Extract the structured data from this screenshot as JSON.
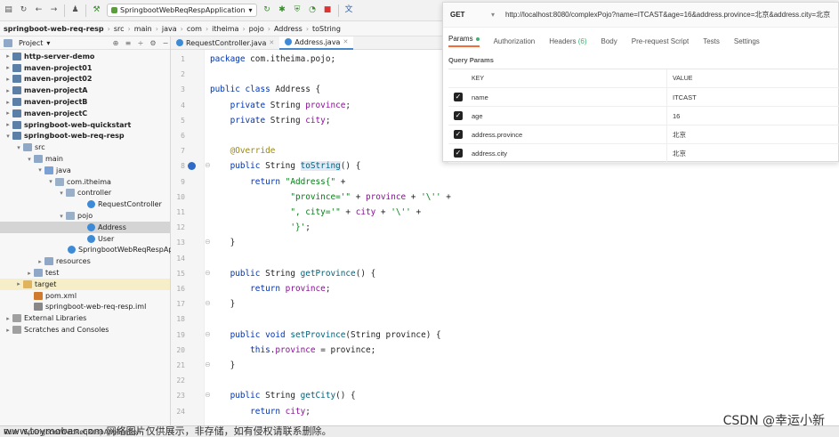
{
  "toolbar": {
    "run_config": "SpringbootWebReqRespApplication",
    "icons": [
      "save-icon",
      "sync-icon",
      "back-icon",
      "forward-icon",
      "vcs-icon",
      "build-icon",
      "run-icon",
      "debug-icon",
      "coverage-icon",
      "profile-icon",
      "stop-icon",
      "translate-icon"
    ]
  },
  "breadcrumb": [
    "springboot-web-req-resp",
    "src",
    "main",
    "java",
    "com",
    "itheima",
    "pojo",
    "Address",
    "toString"
  ],
  "project": {
    "header": "Project",
    "tree": [
      {
        "label": "http-server-demo",
        "bold": true,
        "icon": "module",
        "indent": 0,
        "arrow": "▸"
      },
      {
        "label": "maven-project01",
        "bold": true,
        "icon": "module",
        "indent": 0,
        "arrow": "▸"
      },
      {
        "label": "maven-project02",
        "bold": true,
        "icon": "module",
        "indent": 0,
        "arrow": "▸"
      },
      {
        "label": "maven-projectA",
        "bold": true,
        "icon": "module",
        "indent": 0,
        "arrow": "▸"
      },
      {
        "label": "maven-projectB",
        "bold": true,
        "icon": "module",
        "indent": 0,
        "arrow": "▸"
      },
      {
        "label": "maven-projectC",
        "bold": true,
        "icon": "module",
        "indent": 0,
        "arrow": "▸"
      },
      {
        "label": "springboot-web-quickstart",
        "bold": true,
        "icon": "module",
        "indent": 0,
        "arrow": "▸"
      },
      {
        "label": "springboot-web-req-resp",
        "bold": true,
        "icon": "module",
        "indent": 0,
        "arrow": "▾"
      },
      {
        "label": "src",
        "bold": false,
        "icon": "folder",
        "indent": 1,
        "arrow": "▾"
      },
      {
        "label": "main",
        "bold": false,
        "icon": "folder",
        "indent": 2,
        "arrow": "▾"
      },
      {
        "label": "java",
        "bold": false,
        "icon": "srcfolder",
        "indent": 3,
        "arrow": "▾"
      },
      {
        "label": "com.itheima",
        "bold": false,
        "icon": "pkg",
        "indent": 4,
        "arrow": "▾"
      },
      {
        "label": "controller",
        "bold": false,
        "icon": "pkg",
        "indent": 5,
        "arrow": "▾"
      },
      {
        "label": "RequestController",
        "bold": false,
        "icon": "cls",
        "indent": 7,
        "arrow": ""
      },
      {
        "label": "pojo",
        "bold": false,
        "icon": "pkg",
        "indent": 5,
        "arrow": "▾"
      },
      {
        "label": "Address",
        "bold": false,
        "icon": "cls",
        "indent": 7,
        "arrow": "",
        "selected": true
      },
      {
        "label": "User",
        "bold": false,
        "icon": "cls",
        "indent": 7,
        "arrow": ""
      },
      {
        "label": "SpringbootWebReqRespAp",
        "bold": false,
        "icon": "cls",
        "indent": 6,
        "arrow": ""
      },
      {
        "label": "resources",
        "bold": false,
        "icon": "folder",
        "indent": 3,
        "arrow": "▸"
      },
      {
        "label": "test",
        "bold": false,
        "icon": "folder",
        "indent": 2,
        "arrow": "▸"
      },
      {
        "label": "target",
        "bold": false,
        "icon": "excl",
        "indent": 1,
        "arrow": "▸",
        "target": true
      },
      {
        "label": "pom.xml",
        "bold": false,
        "icon": "xml",
        "indent": 2,
        "arrow": ""
      },
      {
        "label": "springboot-web-req-resp.iml",
        "bold": false,
        "icon": "iml",
        "indent": 2,
        "arrow": ""
      },
      {
        "label": "External Libraries",
        "bold": false,
        "icon": "lib",
        "indent": 0,
        "arrow": "▸"
      },
      {
        "label": "Scratches and Consoles",
        "bold": false,
        "icon": "lib",
        "indent": 0,
        "arrow": "▸"
      }
    ]
  },
  "editor": {
    "tabs": [
      {
        "label": "RequestController.java",
        "active": false
      },
      {
        "label": "Address.java",
        "active": true
      }
    ],
    "first_line": 1,
    "lines": [
      [
        [
          "kw",
          "package "
        ],
        [
          "plain",
          "com.itheima.pojo;"
        ]
      ],
      [],
      [
        [
          "kw",
          "public class "
        ],
        [
          "plain",
          "Address {"
        ]
      ],
      [
        [
          "plain",
          "    "
        ],
        [
          "kw",
          "private "
        ],
        [
          "plain",
          "String "
        ],
        [
          "fld",
          "province"
        ],
        [
          "plain",
          ";"
        ]
      ],
      [
        [
          "plain",
          "    "
        ],
        [
          "kw",
          "private "
        ],
        [
          "plain",
          "String "
        ],
        [
          "fld",
          "city"
        ],
        [
          "plain",
          ";"
        ]
      ],
      [],
      [
        [
          "plain",
          "    "
        ],
        [
          "ann",
          "@Override"
        ]
      ],
      [
        [
          "plain",
          "    "
        ],
        [
          "kw",
          "public "
        ],
        [
          "plain",
          "String "
        ],
        [
          "fn-hl",
          "toString"
        ],
        [
          "plain",
          "() {"
        ]
      ],
      [
        [
          "plain",
          "        "
        ],
        [
          "kw",
          "return "
        ],
        [
          "str",
          "\"Address{\""
        ],
        [
          "plain",
          " +"
        ]
      ],
      [
        [
          "plain",
          "                "
        ],
        [
          "str",
          "\"province='\""
        ],
        [
          "plain",
          " + "
        ],
        [
          "fld",
          "province"
        ],
        [
          "plain",
          " + "
        ],
        [
          "str",
          "'\\''"
        ],
        [
          "plain",
          " +"
        ]
      ],
      [
        [
          "plain",
          "                "
        ],
        [
          "str",
          "\", city='\""
        ],
        [
          "plain",
          " + "
        ],
        [
          "fld",
          "city"
        ],
        [
          "plain",
          " + "
        ],
        [
          "str",
          "'\\''"
        ],
        [
          "plain",
          " +"
        ]
      ],
      [
        [
          "plain",
          "                "
        ],
        [
          "str",
          "'}'"
        ],
        [
          "plain",
          ";"
        ]
      ],
      [
        [
          "plain",
          "    }"
        ]
      ],
      [],
      [
        [
          "plain",
          "    "
        ],
        [
          "kw",
          "public "
        ],
        [
          "plain",
          "String "
        ],
        [
          "fn",
          "getProvince"
        ],
        [
          "plain",
          "() {"
        ]
      ],
      [
        [
          "plain",
          "        "
        ],
        [
          "kw",
          "return "
        ],
        [
          "fld",
          "province"
        ],
        [
          "plain",
          ";"
        ]
      ],
      [
        [
          "plain",
          "    }"
        ]
      ],
      [],
      [
        [
          "plain",
          "    "
        ],
        [
          "kw",
          "public void "
        ],
        [
          "fn",
          "setProvince"
        ],
        [
          "plain",
          "(String province) {"
        ]
      ],
      [
        [
          "plain",
          "        "
        ],
        [
          "kw",
          "this"
        ],
        [
          "plain",
          "."
        ],
        [
          "fld",
          "province"
        ],
        [
          "plain",
          " = province;"
        ]
      ],
      [
        [
          "plain",
          "    }"
        ]
      ],
      [],
      [
        [
          "plain",
          "    "
        ],
        [
          "kw",
          "public "
        ],
        [
          "plain",
          "String "
        ],
        [
          "fn",
          "getCity"
        ],
        [
          "plain",
          "() {"
        ]
      ],
      [
        [
          "plain",
          "        "
        ],
        [
          "kw",
          "return "
        ],
        [
          "fld",
          "city"
        ],
        [
          "plain",
          ";"
        ]
      ]
    ]
  },
  "postman": {
    "method": "GET",
    "url": "http://localhost:8080/complexPojo?name=ITCAST&age=16&address.province=北京&address.city=北京",
    "tabs": [
      {
        "label": "Params",
        "active": true,
        "dot": true
      },
      {
        "label": "Authorization"
      },
      {
        "label": "Headers",
        "count": "(6)"
      },
      {
        "label": "Body"
      },
      {
        "label": "Pre-request Script"
      },
      {
        "label": "Tests"
      },
      {
        "label": "Settings"
      }
    ],
    "section_title": "Query Params",
    "col_key": "KEY",
    "col_value": "VALUE",
    "params": [
      {
        "key": "name",
        "value": "ITCAST"
      },
      {
        "key": "age",
        "value": "16"
      },
      {
        "key": "address.province",
        "value": "北京"
      },
      {
        "key": "address.city",
        "value": "北京"
      }
    ]
  },
  "statusbar": {
    "run_label": "Run:",
    "run_target": "SpringbootWebReqRespApplication"
  },
  "watermark": "www.toymoban.com 网络图片仅供展示，非存储，如有侵权请联系删除。",
  "csdn_mark": "CSDN @幸运小新",
  "colors": {
    "accent_tab": "#4a88c7",
    "postman_active": "#f26b3a",
    "keyword": "#0033b3",
    "string": "#067d17",
    "field": "#871094"
  }
}
